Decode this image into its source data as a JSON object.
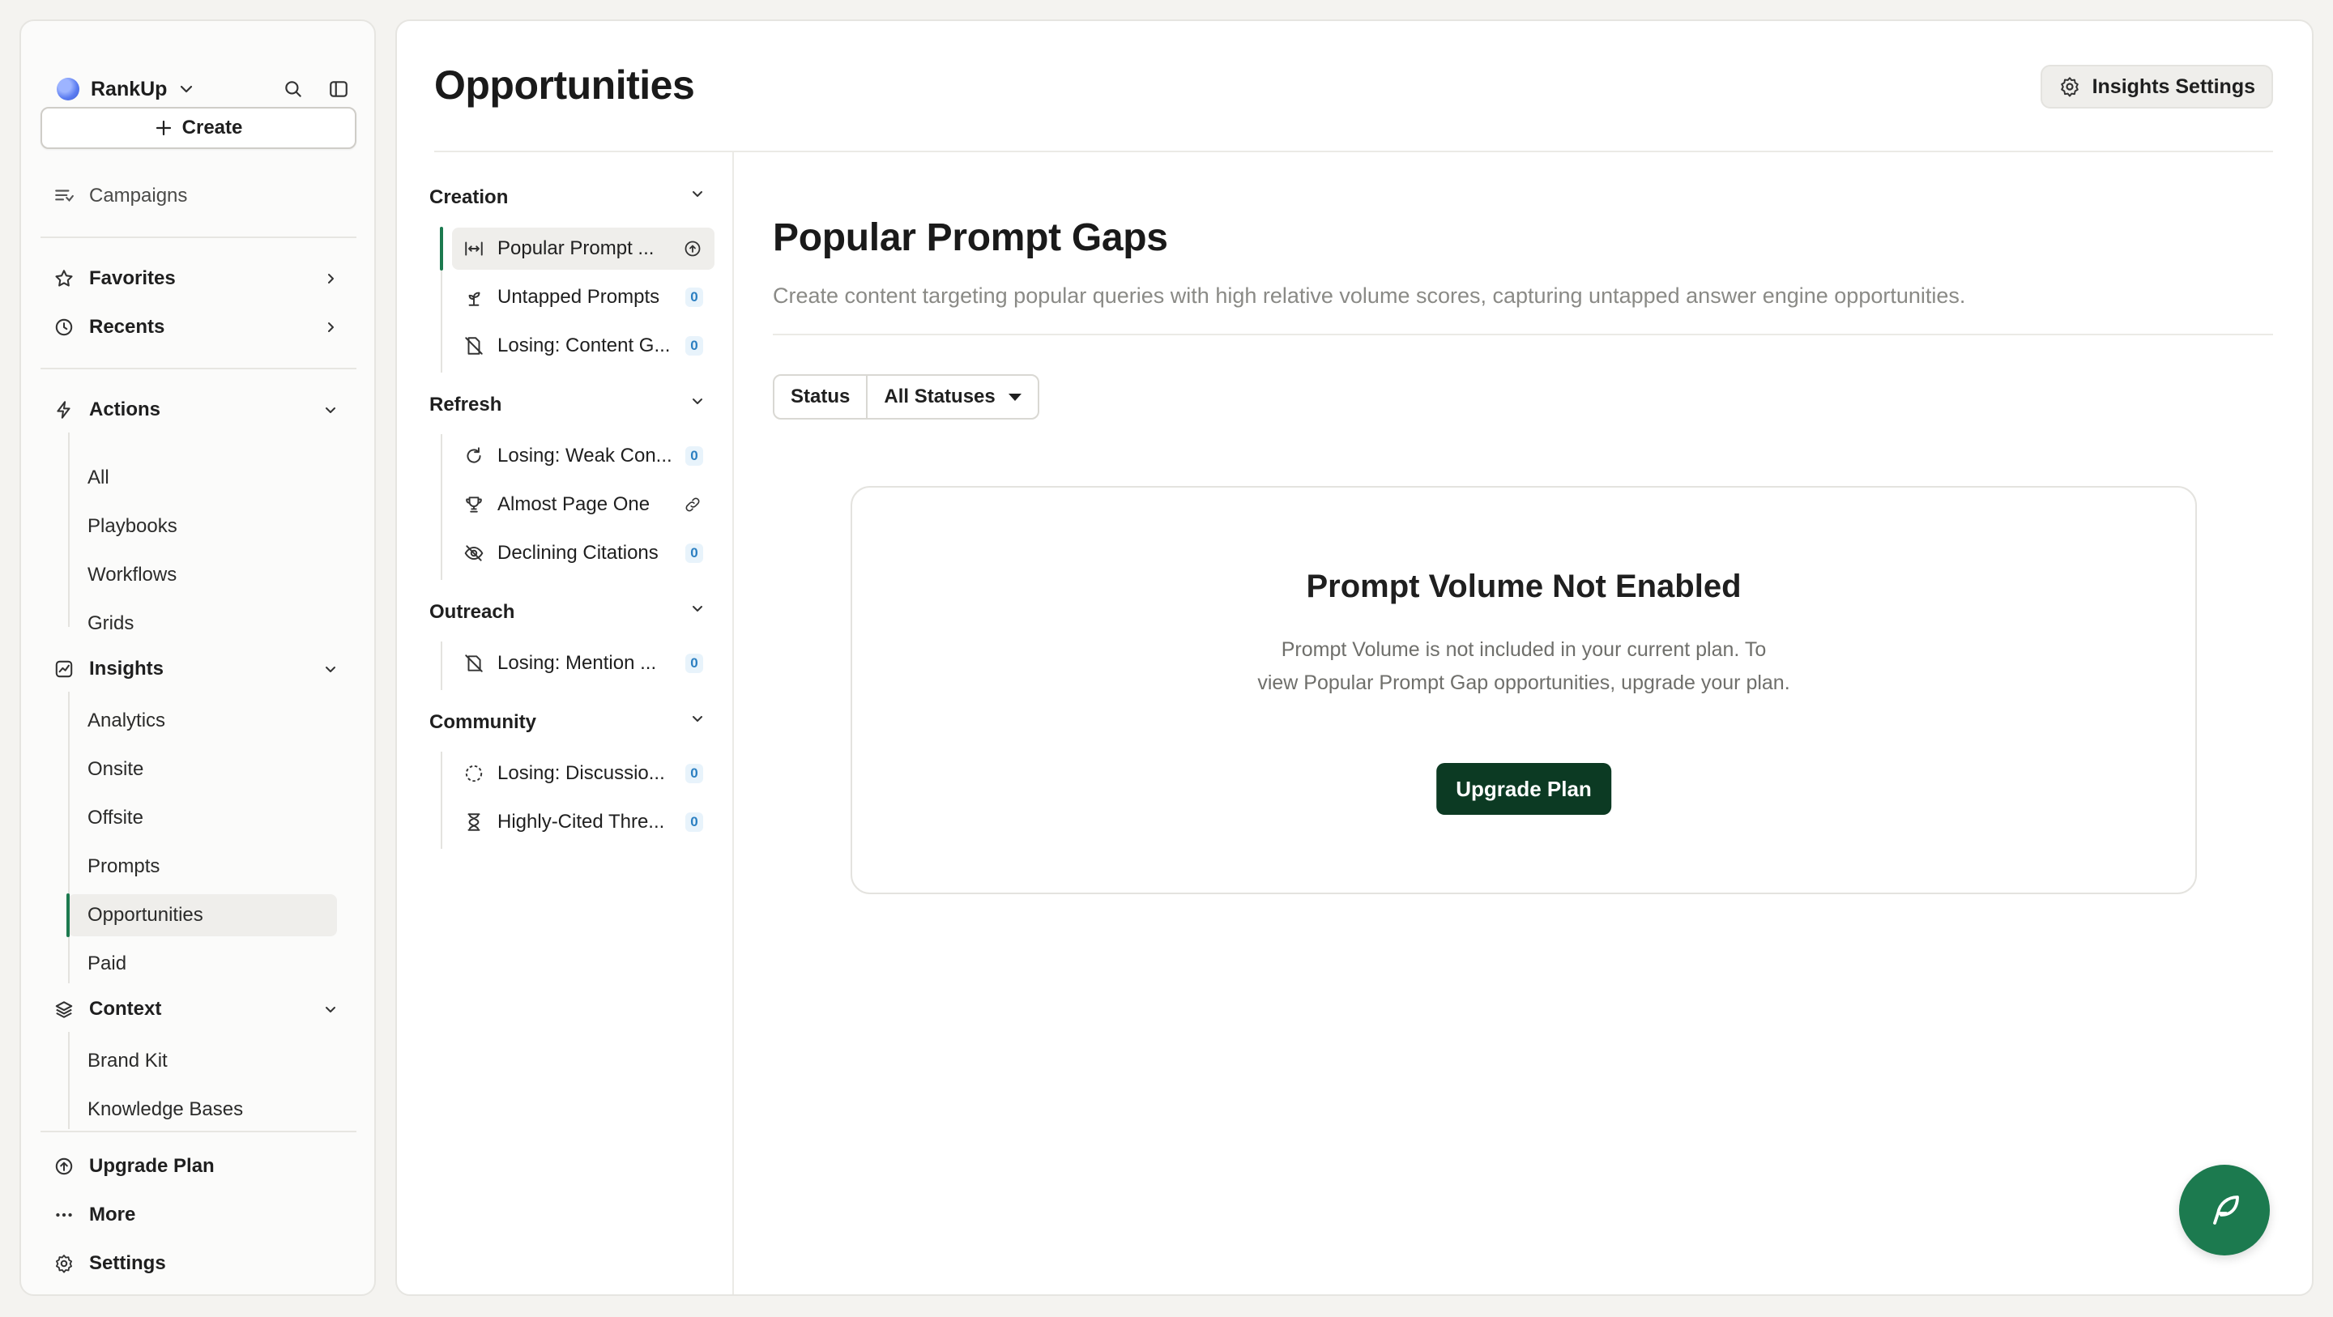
{
  "brand": {
    "name": "RankUp"
  },
  "sidebar": {
    "create_label": "Create",
    "campaigns": "Campaigns",
    "favorites": "Favorites",
    "recents": "Recents",
    "actions": {
      "label": "Actions",
      "items": [
        "All",
        "Playbooks",
        "Workflows",
        "Grids"
      ]
    },
    "insights": {
      "label": "Insights",
      "items": [
        "Analytics",
        "Onsite",
        "Offsite",
        "Prompts",
        "Opportunities",
        "Paid"
      ],
      "active": "Opportunities"
    },
    "context": {
      "label": "Context",
      "items": [
        "Brand Kit",
        "Knowledge Bases"
      ]
    },
    "upgrade_plan": "Upgrade Plan",
    "more": "More",
    "settings": "Settings"
  },
  "main": {
    "title": "Opportunities",
    "insights_settings": "Insights Settings"
  },
  "categories": [
    {
      "label": "Creation",
      "items": [
        {
          "label": "Popular Prompt Gaps",
          "display": "Popular Prompt ...",
          "icon": "arrows-width-icon",
          "trailing": "upgrade-icon",
          "active": true
        },
        {
          "label": "Untapped Prompts",
          "icon": "sprout-icon",
          "count": "0"
        },
        {
          "label": "Losing: Content G...",
          "icon": "file-off-icon",
          "count": "0"
        }
      ]
    },
    {
      "label": "Refresh",
      "items": [
        {
          "label": "Losing: Weak Con...",
          "icon": "refresh-doc-icon",
          "count": "0"
        },
        {
          "label": "Almost Page One",
          "icon": "trophy-icon",
          "trailing": "link-icon"
        },
        {
          "label": "Declining Citations",
          "icon": "eye-off-icon",
          "count": "0"
        }
      ]
    },
    {
      "label": "Outreach",
      "items": [
        {
          "label": "Losing: Mention ...",
          "icon": "mention-off-icon",
          "count": "0"
        }
      ]
    },
    {
      "label": "Community",
      "items": [
        {
          "label": "Losing: Discussio...",
          "icon": "dashed-circle-icon",
          "count": "0"
        },
        {
          "label": "Highly-Cited Thre...",
          "icon": "hourglass-icon",
          "count": "0"
        }
      ]
    }
  ],
  "content": {
    "title": "Popular Prompt Gaps",
    "description": "Create content targeting popular queries with high relative volume scores, capturing untapped answer engine opportunities.",
    "filter": {
      "label": "Status",
      "value": "All Statuses"
    },
    "empty_state": {
      "title": "Prompt Volume Not Enabled",
      "line1": "Prompt Volume is not included in your current plan. To",
      "line2": "view Popular Prompt Gap opportunities, upgrade your plan.",
      "button": "Upgrade Plan"
    }
  },
  "colors": {
    "accent": "#1c7a4f",
    "button_dark": "#0c3a23",
    "count_badge": "#2b7fc1"
  }
}
